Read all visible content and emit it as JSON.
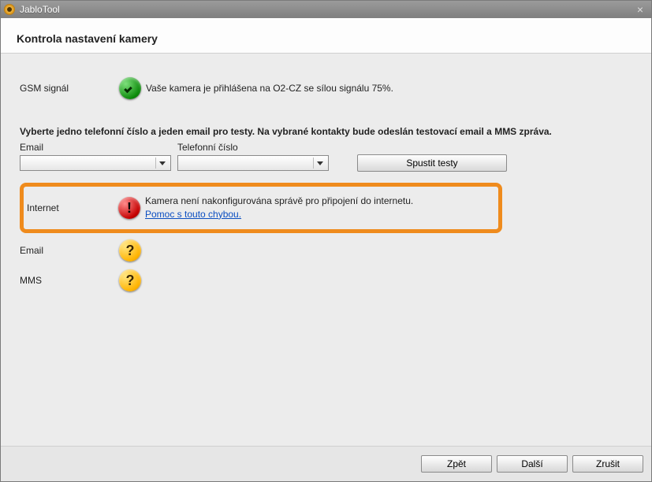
{
  "window": {
    "title": "JabloTool"
  },
  "page": {
    "heading": "Kontrola nastavení kamery"
  },
  "gsm": {
    "label": "GSM signál",
    "message": "Vaše kamera je přihlášena na O2-CZ se sílou signálu 75%."
  },
  "instruction": "Vyberte jedno telefonní číslo a jeden email pro testy. Na vybrané kontakty bude odeslán testovací email a MMS zpráva.",
  "fields": {
    "email_label": "Email",
    "phone_label": "Telefonní číslo",
    "email_value": "",
    "phone_value": "",
    "run_tests": "Spustit testy"
  },
  "internet": {
    "label": "Internet",
    "message": "Kamera není nakonfigurována správě pro připojení do internetu.",
    "help_link": "Pomoc s touto chybou."
  },
  "email_test": {
    "label": "Email"
  },
  "mms_test": {
    "label": "MMS"
  },
  "footer": {
    "back": "Zpět",
    "next": "Další",
    "cancel": "Zrušit"
  }
}
